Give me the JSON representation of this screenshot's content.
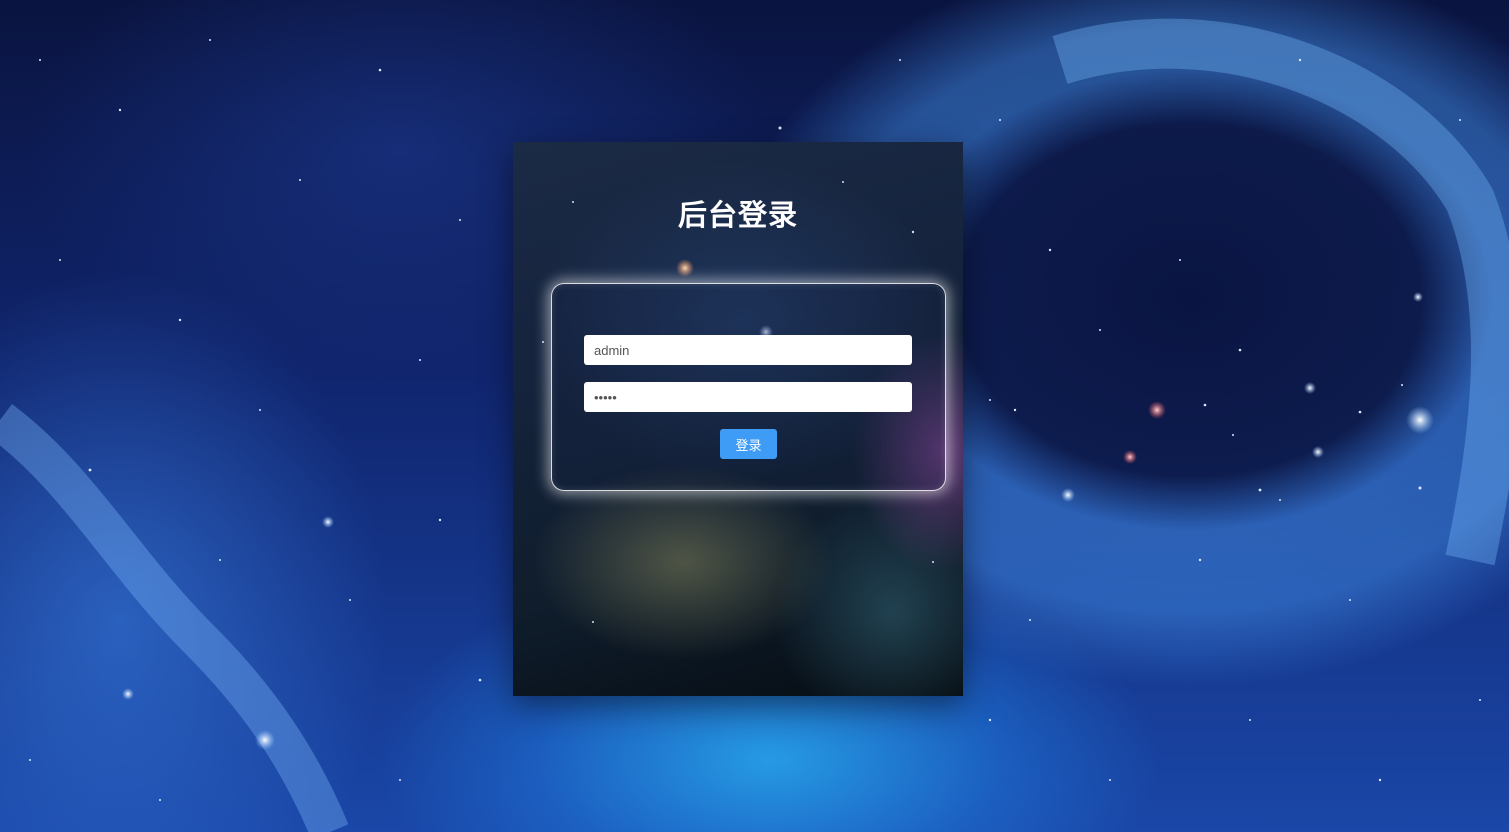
{
  "login": {
    "title": "后台登录",
    "username_value": "admin",
    "password_value": "•••••",
    "submit_label": "登录"
  },
  "colors": {
    "button": "#3f9cf6",
    "title_text": "#ffffff",
    "field_background": "#ffffff",
    "page_background": "#10256e"
  }
}
